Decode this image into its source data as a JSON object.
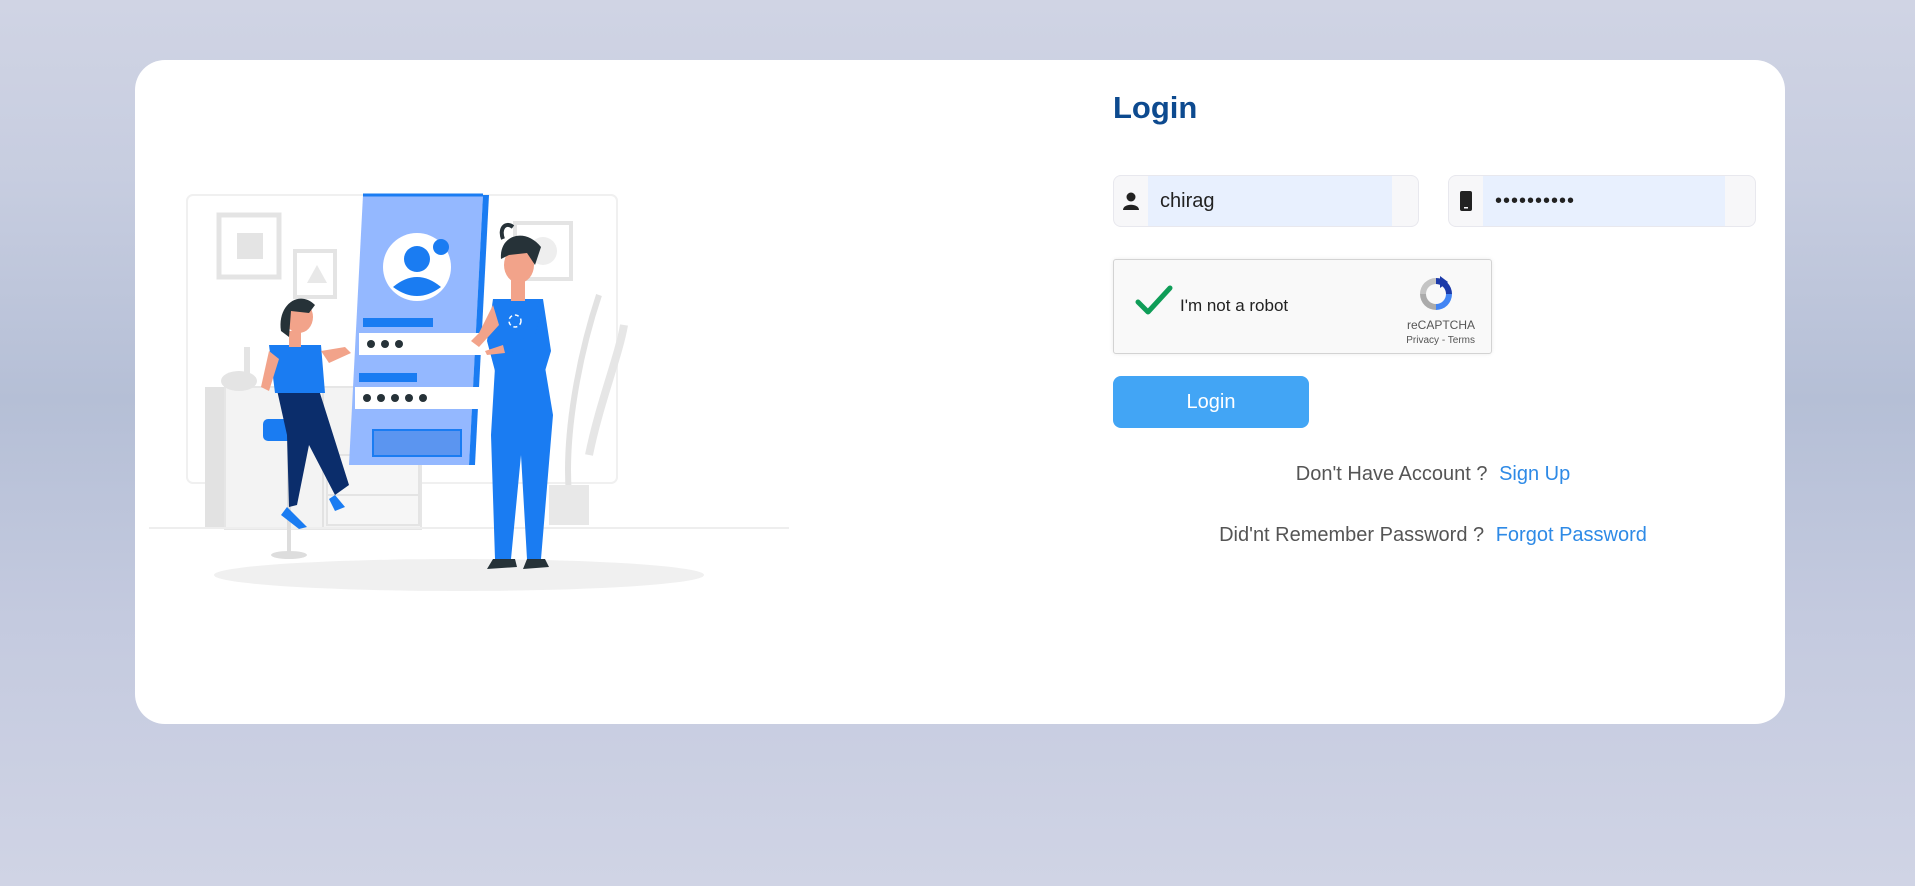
{
  "login": {
    "title": "Login",
    "username": {
      "value": "chirag",
      "icon": "user-icon"
    },
    "password": {
      "value": "••••••••••",
      "icon": "mobile-phone-icon"
    },
    "captcha": {
      "label": "I'm not a robot",
      "checked": true,
      "brand": "reCAPTCHA",
      "privacy": "Privacy",
      "separator": " - ",
      "terms": "Terms"
    },
    "button_label": "Login",
    "signup_prompt": "Don't Have Account ?",
    "signup_link": "Sign Up",
    "forgot_prompt": "Did'nt Remember Password ?",
    "forgot_link": "Forgot Password"
  },
  "colors": {
    "title": "#0d4a8f",
    "button": "#42a5f5",
    "link": "#2e8ae6",
    "accent_blue": "#1a7cf2",
    "checkmark": "#0f9d58"
  }
}
